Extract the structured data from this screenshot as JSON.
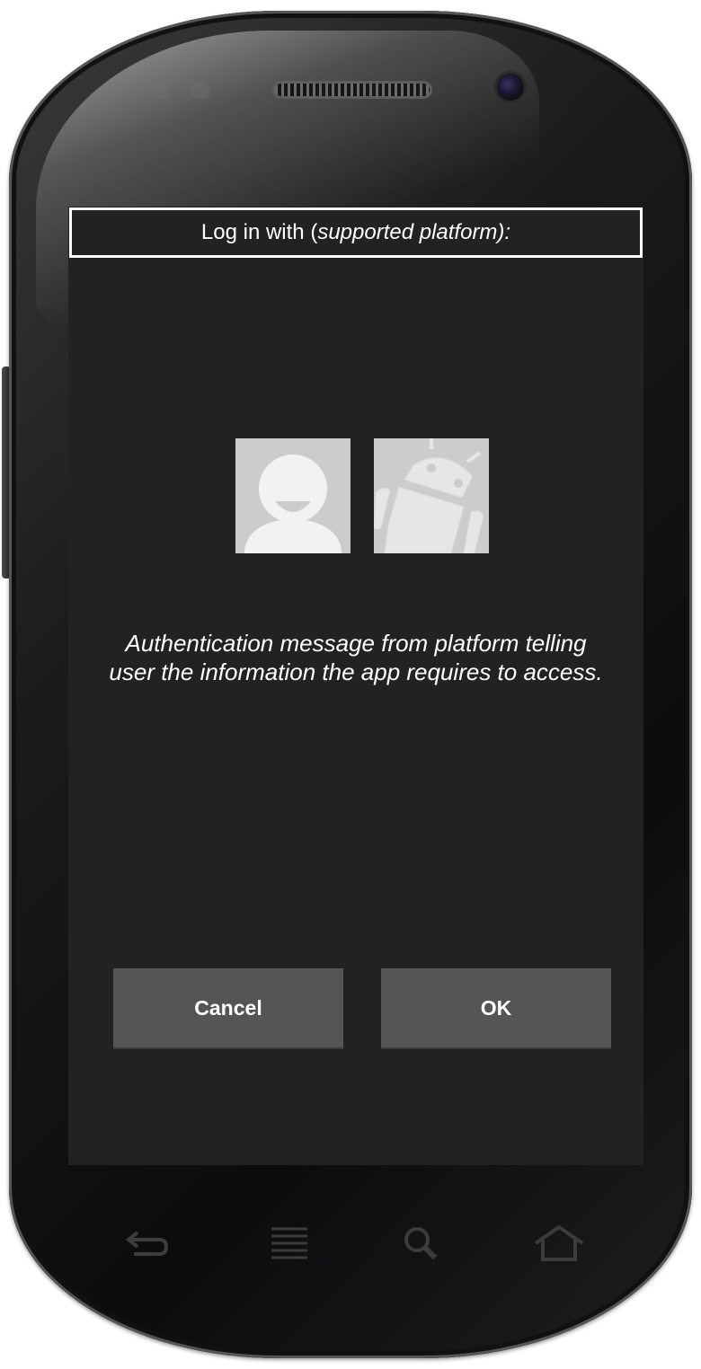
{
  "dialog": {
    "title_prefix": "Log in with (",
    "title_italic": "supported platform):",
    "message": "Authentication message from platform telling user the information the app requires to access.",
    "cancel_label": "Cancel",
    "ok_label": "OK"
  },
  "icons": {
    "user": "user-avatar-icon",
    "android": "android-icon"
  },
  "nav_keys": [
    "back-icon",
    "menu-icon",
    "search-icon",
    "home-icon"
  ],
  "colors": {
    "screen_bg": "#222222",
    "button_bg": "#555555",
    "icon_tile_bg": "#cccccc",
    "text": "#ffffff"
  }
}
